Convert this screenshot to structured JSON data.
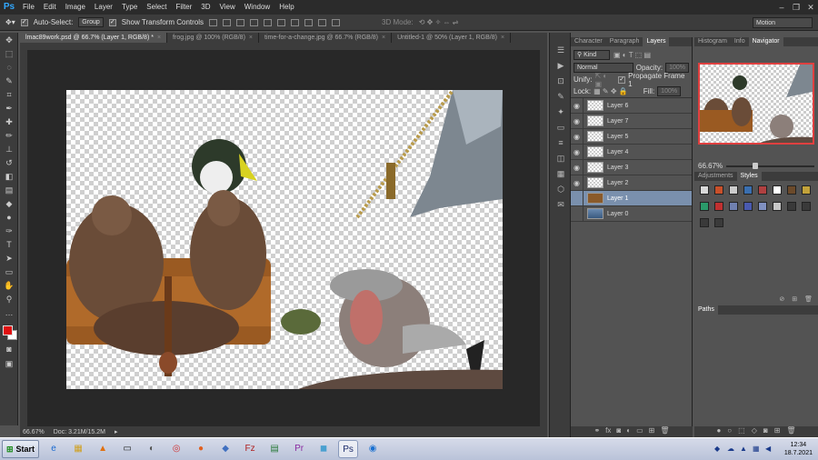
{
  "app": {
    "logo": "Ps"
  },
  "menu": [
    "File",
    "Edit",
    "Image",
    "Layer",
    "Type",
    "Select",
    "Filter",
    "3D",
    "View",
    "Window",
    "Help"
  ],
  "window_controls": [
    "–",
    "❐",
    "✕"
  ],
  "options": {
    "auto_select_label": "Auto-Select:",
    "auto_select_value": "Group",
    "show_transform_label": "Show Transform Controls",
    "mode_3d_label": "3D Mode:",
    "workspace": "Motion"
  },
  "doc_tabs": [
    {
      "label": "lmac89work.psd @ 66.7% (Layer 1, RGB/8) *",
      "active": true
    },
    {
      "label": "frog.jpg @ 100% (RGB/8)",
      "active": false
    },
    {
      "label": "time-for-a-change.jpg @ 66.7% (RGB/8)",
      "active": false
    },
    {
      "label": "Untitled-1 @ 50% (Layer 1, RGB/8)",
      "active": false
    }
  ],
  "status": {
    "zoom": "66.67%",
    "doc": "Doc: 3.21M/15.2M"
  },
  "layers_panel": {
    "tabs": [
      "Character",
      "Paragraph",
      "Layers"
    ],
    "active_tab": "Layers",
    "filter_kind": "Kind",
    "blend_mode": "Normal",
    "opacity_label": "Opacity:",
    "opacity_value": "100%",
    "unify_label": "Unify:",
    "propagate_label": "Propagate Frame 1",
    "lock_label": "Lock:",
    "fill_label": "Fill:",
    "fill_value": "100%",
    "layers": [
      {
        "name": "Layer 6",
        "visible": true,
        "selected": false
      },
      {
        "name": "Layer 7",
        "visible": true,
        "selected": false
      },
      {
        "name": "Layer 5",
        "visible": true,
        "selected": false
      },
      {
        "name": "Layer 4",
        "visible": true,
        "selected": false
      },
      {
        "name": "Layer 3",
        "visible": true,
        "selected": false
      },
      {
        "name": "Layer 2",
        "visible": true,
        "selected": false
      },
      {
        "name": "Layer 1",
        "visible": false,
        "selected": true
      },
      {
        "name": "Layer 0",
        "visible": false,
        "selected": false
      }
    ]
  },
  "navigator_panel": {
    "tabs": [
      "Histogram",
      "Info",
      "Navigator"
    ],
    "active_tab": "Navigator",
    "zoom": "66.67%"
  },
  "styles_panel": {
    "tabs": [
      "Adjustments",
      "Styles"
    ],
    "active_tab": "Styles",
    "swatch_colors": [
      "#d9d9d9",
      "#c8502a",
      "#cccccc",
      "#3a6fb0",
      "#b04040",
      "#ffffff",
      "#6b4a2a",
      "#c2a23a",
      "#2a9a6a",
      "#c03030",
      "#7080b0",
      "#4a5ab0",
      "#8090c0",
      "#c8c8c8",
      "#3a3a3a",
      "#3a3a3a",
      "#3a3a3a",
      "#3a3a3a"
    ]
  },
  "paths_panel": {
    "tab": "Paths"
  },
  "taskbar": {
    "start_label": "Start",
    "apps": [
      "e",
      "▦",
      "▲",
      "▭",
      "◐",
      "◎",
      "●",
      "◆",
      "Fz",
      "▤",
      "Pr",
      "◼",
      "Ps",
      "◉"
    ],
    "active_app_index": 12,
    "time": "12:34",
    "date": "18.7.2021"
  }
}
